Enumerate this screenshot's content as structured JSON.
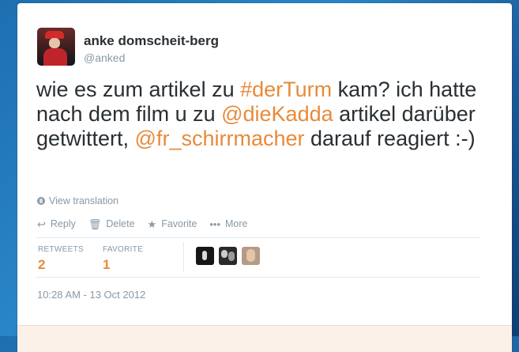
{
  "tweet": {
    "author_name": "anke domscheit-berg",
    "author_handle": "@anked",
    "text_parts": {
      "p1": "wie es zum artikel zu ",
      "hashtag": "#derTurm",
      "p2": " kam? ich hatte nach dem film u zu ",
      "mention1": "@dieKadda",
      "p3": " artikel darüber getwittert, ",
      "mention2": "@fr_schirrmacher",
      "p4": " darauf reagiert :-)"
    },
    "translate_label": "View translation",
    "timestamp": "10:28 AM - 13 Oct 2012"
  },
  "actions": {
    "reply": "Reply",
    "delete": "Delete",
    "favorite": "Favorite",
    "more": "More"
  },
  "stats": {
    "retweets_label": "RETWEETS",
    "retweets_count": "2",
    "favorites_label": "FAVORITE",
    "favorites_count": "1"
  },
  "colors": {
    "link": "#e88a3b",
    "text": "#292f33",
    "muted": "#8899a6"
  }
}
